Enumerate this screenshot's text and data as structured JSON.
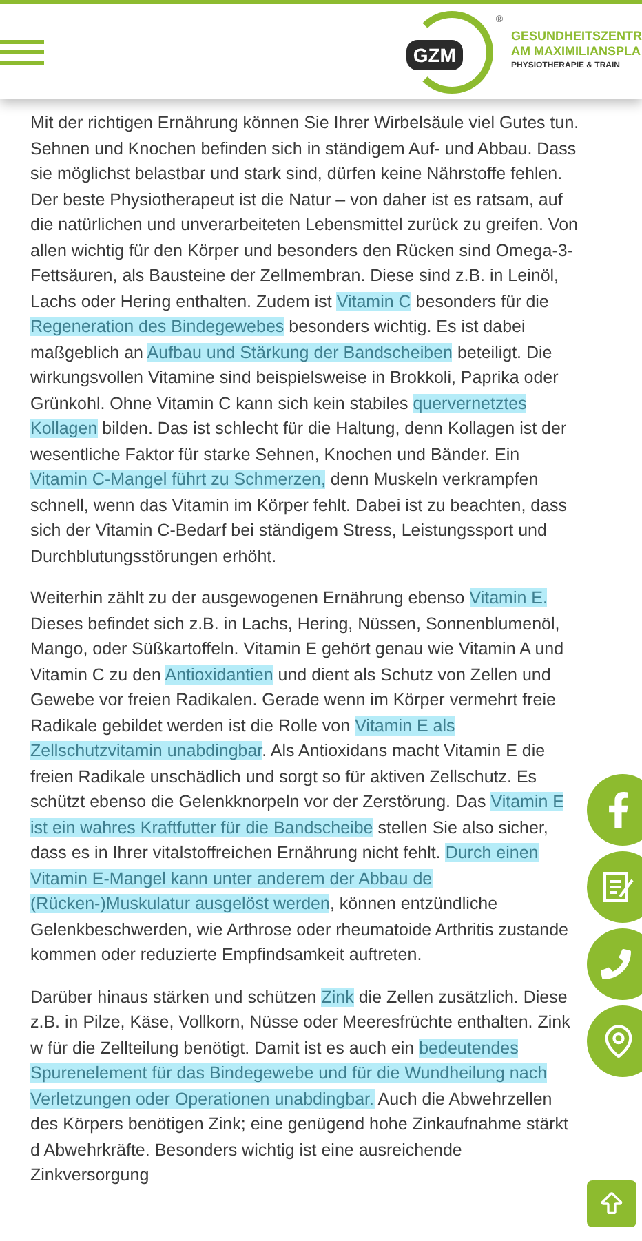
{
  "header": {
    "logo": {
      "badge": "GZM",
      "registered": "®",
      "line_1": "GESUNDHEITSZENTR",
      "line_2": "AM MAXIMILIANSPLA",
      "line_3": "PHYSIOTHERAPIE & TRAIN"
    }
  },
  "paragraphs": [
    [
      {
        "text": "Mit der richtigen Ernährung können Sie Ihrer Wirbelsäule viel Gutes tun. Sehnen und Knochen befinden sich in ständigem Auf- und Abbau. Dass sie möglichst belastbar und stark sind, dürfen keine Nährstoffe fehlen. Der beste Physiotherapeut ist die Natur – von daher ist es ratsam, auf die natürlichen und unverarbeiteten Lebensmittel zurück zu greifen. Von allen wichtig für den Körper und besonders den Rücken sind Omega-3-Fettsäuren, als Bausteine der Zellmembran. Diese sind z.B. in Leinöl, Lachs oder Hering enthalten. Zudem ist ",
        "highlighted": false
      },
      {
        "text": "Vitamin C",
        "highlighted": true
      },
      {
        "text": " besonders für die ",
        "highlighted": false
      },
      {
        "text": "Regeneration des Bindegewebes",
        "highlighted": true
      },
      {
        "text": " besonders wichtig. Es ist dabei maßgeblich an ",
        "highlighted": false
      },
      {
        "text": "Aufbau und Stärkung der Bandscheiben",
        "highlighted": true
      },
      {
        "text": " beteiligt. Die wirkungsvollen Vitamine sind beispielsweise in Brokkoli, Paprika oder Grünkohl. Ohne Vitamin C kann sich kein stabiles ",
        "highlighted": false
      },
      {
        "text": "quervernetztes Kollagen",
        "highlighted": true
      },
      {
        "text": " bilden. Das ist schlecht für die Haltung, denn Kollagen ist der wesentliche Faktor für starke Sehnen, Knochen und Bänder. Ein ",
        "highlighted": false
      },
      {
        "text": "Vitamin C-Mangel führt zu Schmerzen,",
        "highlighted": true
      },
      {
        "text": " denn Muskeln verkrampfen schnell, wenn das Vitamin im Körper fehlt. Dabei ist zu beachten, dass sich der Vitamin C-Bedarf bei ständigem Stress, Leistungssport und Durchblutungsstörungen erhöht.",
        "highlighted": false
      }
    ],
    [
      {
        "text": "Weiterhin zählt zu der ausgewogenen Ernährung ebenso ",
        "highlighted": false
      },
      {
        "text": "Vitamin E.",
        "highlighted": true
      },
      {
        "text": " Dieses befindet sich z.B. in Lachs, Hering, Nüssen, Sonnenblumenöl, Mango, oder Süßkartoffeln. Vitamin E gehört genau wie Vitamin A und Vitamin C zu den ",
        "highlighted": false
      },
      {
        "text": "Antioxidantien",
        "highlighted": true
      },
      {
        "text": " und dient als Schutz von Zellen und Gewebe vor freien Radikalen. Gerade wenn im Körper vermehrt freie Radikale gebildet werden ist die Rolle von ",
        "highlighted": false
      },
      {
        "text": "Vitamin E als Zellschutzvitamin unabdingbar",
        "highlighted": true
      },
      {
        "text": ". Als Antioxidans macht Vitamin E die freien Radikale unschädlich und sorgt so für aktiven Zellschutz. Es schützt ebenso die Gelenkknorpeln vor der Zerstörung. Das ",
        "highlighted": false
      },
      {
        "text": "Vitamin E ist ein wahres Kraftfutter für die Bandscheibe",
        "highlighted": true
      },
      {
        "text": " stellen Sie also sicher, dass es in Ihrer vitalstoffreichen Ernährung nicht fehlt. ",
        "highlighted": false
      },
      {
        "text": "Durch einen Vitamin E-Mangel kann unter anderem der Abbau de (Rücken-)Muskulatur ausgelöst werden",
        "highlighted": true
      },
      {
        "text": ", können entzündliche Gelenkbeschwerden, wie Arthrose oder rheumatoide Arthritis zustande kommen oder reduzierte Empfindsamkeit auftreten.",
        "highlighted": false
      }
    ],
    [
      {
        "text": "Darüber hinaus stärken und schützen ",
        "highlighted": false
      },
      {
        "text": "Zink",
        "highlighted": true
      },
      {
        "text": " die Zellen zusätzlich. Diese z.B. in Pilze, Käse, Vollkorn, Nüsse oder Meeresfrüchte enthalten. Zink w für die Zellteilung benötigt. Damit ist es auch ein ",
        "highlighted": false
      },
      {
        "text": "bedeutendes Spurenelement für das Bindegewebe und für die Wundheilung nach Verletzungen oder Operationen unabdingbar.",
        "highlighted": true
      },
      {
        "text": " Auch die Abwehrzellen des Körpers benötigen Zink; eine genügend hohe Zinkaufnahme stärkt d Abwehrkräfte. Besonders wichtig ist eine ausreichende Zinkversorgung",
        "highlighted": false
      }
    ]
  ],
  "side_buttons": [
    {
      "kind": "facebook"
    },
    {
      "kind": "notes"
    },
    {
      "kind": "phone"
    },
    {
      "kind": "location"
    }
  ],
  "scroll_top": {
    "kind": "arrow_up"
  }
}
